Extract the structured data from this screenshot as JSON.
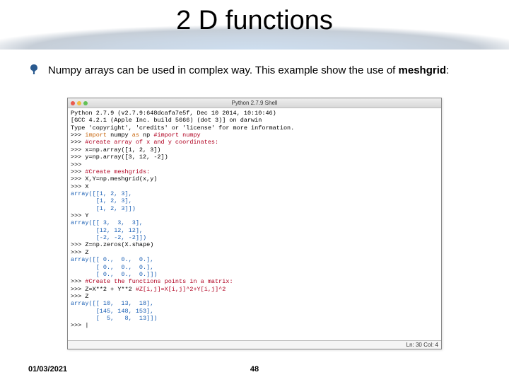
{
  "title": "2 D functions",
  "bullet": {
    "text_before": "Numpy arrays can be used in complex way. This example show the use of ",
    "bold": "meshgrid",
    "text_after": ":"
  },
  "shell": {
    "title": "Python 2.7.9 Shell",
    "status": "Ln: 30 Col: 4",
    "lines": [
      {
        "t": "Python 2.7.9 (v2.7.9:648dcafa7e5f, Dec 10 2014, 10:10:46)",
        "cls": ""
      },
      {
        "t": "[GCC 4.2.1 (Apple Inc. build 5666) (dot 3)] on darwin",
        "cls": ""
      },
      {
        "t": "Type 'copyright', 'credits' or 'license' for more information.",
        "cls": ""
      },
      {
        "seg": [
          {
            "t": ">>> ",
            "cls": ""
          },
          {
            "t": "import",
            "cls": "c-kw"
          },
          {
            "t": " numpy ",
            "cls": ""
          },
          {
            "t": "as",
            "cls": "c-kw"
          },
          {
            "t": " np ",
            "cls": ""
          },
          {
            "t": "#import numpy",
            "cls": "c-comment"
          }
        ]
      },
      {
        "seg": [
          {
            "t": ">>> ",
            "cls": ""
          },
          {
            "t": "#create array of x and y coordinates:",
            "cls": "c-comment"
          }
        ]
      },
      {
        "seg": [
          {
            "t": ">>> ",
            "cls": ""
          },
          {
            "t": "x=np.array([1, 2, 3])",
            "cls": ""
          }
        ]
      },
      {
        "seg": [
          {
            "t": ">>> ",
            "cls": ""
          },
          {
            "t": "y=np.array([3, 12, -2])",
            "cls": ""
          }
        ]
      },
      {
        "t": ">>>",
        "cls": ""
      },
      {
        "seg": [
          {
            "t": ">>> ",
            "cls": ""
          },
          {
            "t": "#Create meshgrids:",
            "cls": "c-comment"
          }
        ]
      },
      {
        "seg": [
          {
            "t": ">>> ",
            "cls": ""
          },
          {
            "t": "X,Y=np.meshgrid(x,y)",
            "cls": ""
          }
        ]
      },
      {
        "seg": [
          {
            "t": ">>> ",
            "cls": ""
          },
          {
            "t": "X",
            "cls": ""
          }
        ]
      },
      {
        "t": "array([[1, 2, 3],",
        "cls": "c-blue"
      },
      {
        "t": "       [1, 2, 3],",
        "cls": "c-blue"
      },
      {
        "t": "       [1, 2, 3]])",
        "cls": "c-blue"
      },
      {
        "seg": [
          {
            "t": ">>> ",
            "cls": ""
          },
          {
            "t": "Y",
            "cls": ""
          }
        ]
      },
      {
        "t": "array([[ 3,  3,  3],",
        "cls": "c-blue"
      },
      {
        "t": "       [12, 12, 12],",
        "cls": "c-blue"
      },
      {
        "t": "       [-2, -2, -2]])",
        "cls": "c-blue"
      },
      {
        "seg": [
          {
            "t": ">>> ",
            "cls": ""
          },
          {
            "t": "Z=np.zeros(X.shape)",
            "cls": ""
          }
        ]
      },
      {
        "seg": [
          {
            "t": ">>> ",
            "cls": ""
          },
          {
            "t": "Z",
            "cls": ""
          }
        ]
      },
      {
        "t": "array([[ 0.,  0.,  0.],",
        "cls": "c-blue"
      },
      {
        "t": "       [ 0.,  0.,  0.],",
        "cls": "c-blue"
      },
      {
        "t": "       [ 0.,  0.,  0.]])",
        "cls": "c-blue"
      },
      {
        "seg": [
          {
            "t": ">>> ",
            "cls": ""
          },
          {
            "t": "#Create the functions points in a matrix:",
            "cls": "c-comment"
          }
        ]
      },
      {
        "seg": [
          {
            "t": ">>> ",
            "cls": ""
          },
          {
            "t": "Z=X**2 + Y**2 ",
            "cls": ""
          },
          {
            "t": "#Z[i,j]=X[i,j]^2+Y[i,j]^2",
            "cls": "c-comment"
          }
        ]
      },
      {
        "seg": [
          {
            "t": ">>> ",
            "cls": ""
          },
          {
            "t": "Z",
            "cls": ""
          }
        ]
      },
      {
        "t": "array([[ 10,  13,  18],",
        "cls": "c-blue"
      },
      {
        "t": "       [145, 148, 153],",
        "cls": "c-blue"
      },
      {
        "t": "       [  5,   8,  13]])",
        "cls": "c-blue"
      },
      {
        "t": ">>> |",
        "cls": ""
      }
    ]
  },
  "footer": {
    "date": "01/03/2021",
    "page": "48"
  }
}
